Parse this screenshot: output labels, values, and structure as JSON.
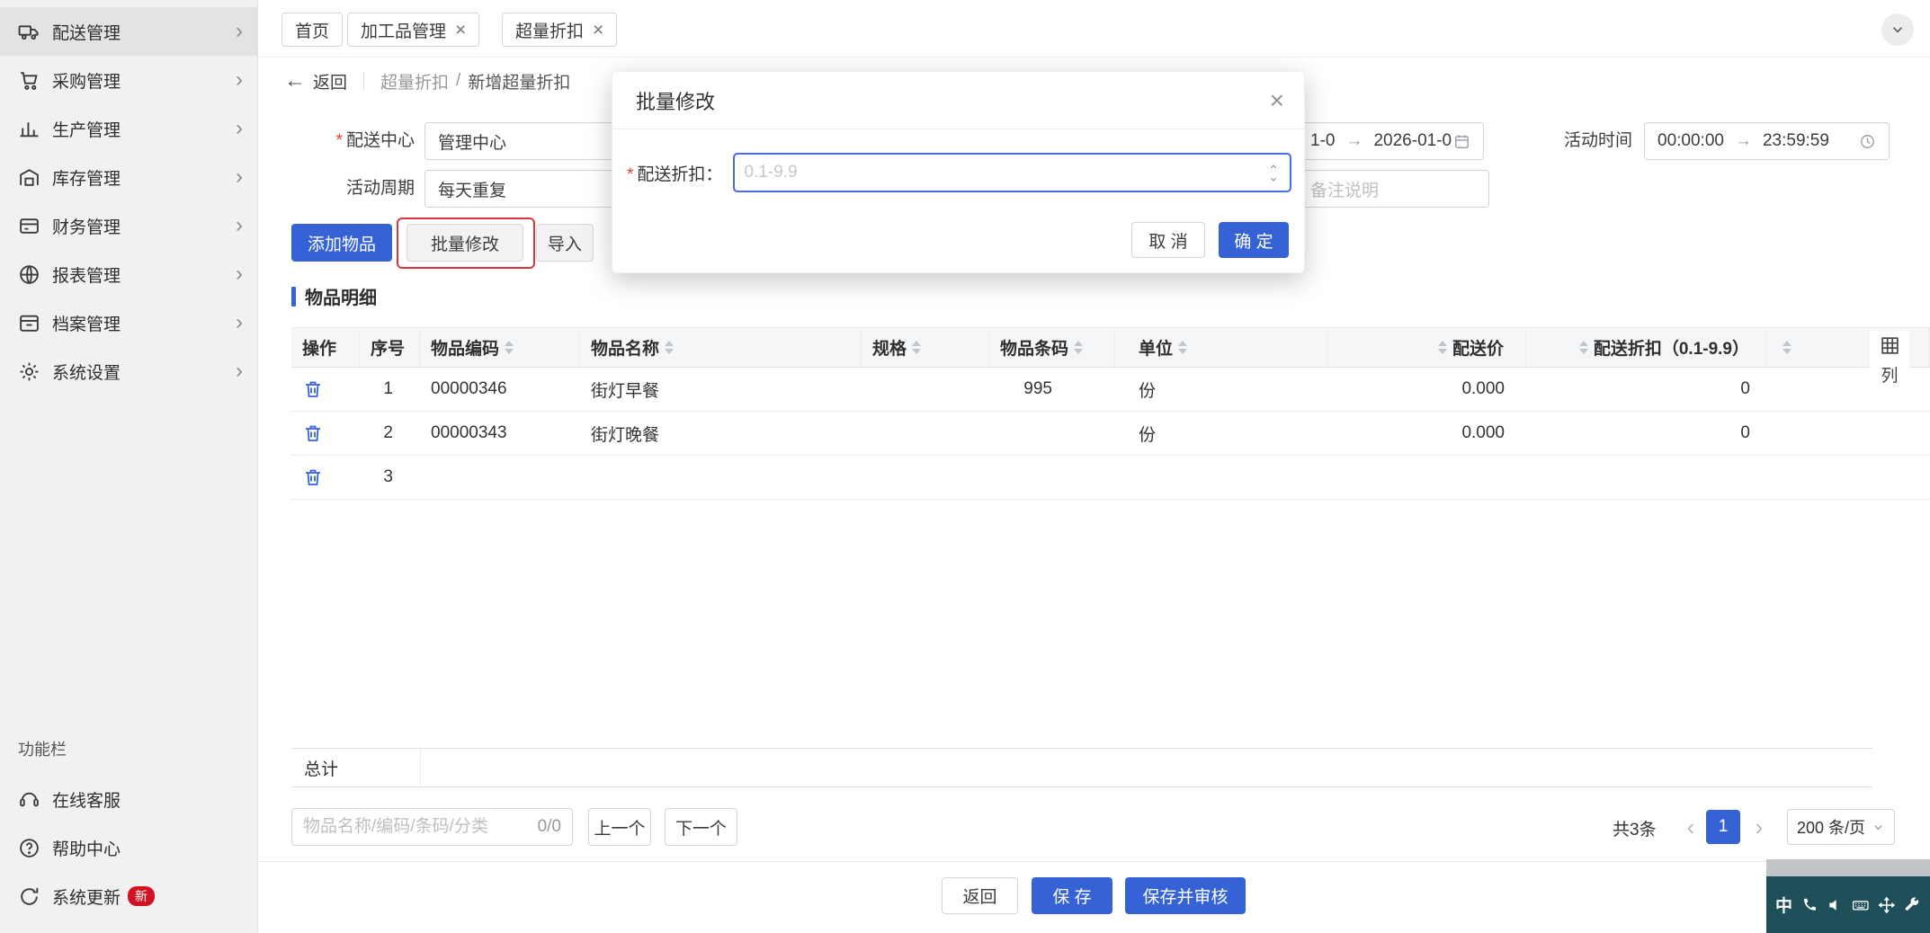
{
  "colors": {
    "primary": "#3563d6",
    "danger": "#d9363e",
    "badge": "#cf1322"
  },
  "icons": {
    "close": "×",
    "back": "←",
    "range_arrow": "→",
    "chevron_right": "›",
    "page_prev": "‹",
    "page_next": "›",
    "required": "*"
  },
  "sidebar": {
    "items": [
      {
        "label": "配送管理",
        "icon": "delivery-truck-icon"
      },
      {
        "label": "采购管理",
        "icon": "cart-icon"
      },
      {
        "label": "生产管理",
        "icon": "production-chart-icon"
      },
      {
        "label": "库存管理",
        "icon": "warehouse-icon"
      },
      {
        "label": "财务管理",
        "icon": "finance-icon"
      },
      {
        "label": "报表管理",
        "icon": "report-globe-icon"
      },
      {
        "label": "档案管理",
        "icon": "archive-icon"
      },
      {
        "label": "系统设置",
        "icon": "gear-icon"
      }
    ],
    "section_label": "功能栏",
    "bottom_items": [
      {
        "label": "在线客服",
        "icon": "service-icon"
      },
      {
        "label": "帮助中心",
        "icon": "help-icon"
      },
      {
        "label": "系统更新",
        "icon": "update-icon",
        "badge": "新"
      }
    ]
  },
  "tabs": [
    {
      "label": "首页"
    },
    {
      "label": "加工品管理"
    },
    {
      "label": "超量折扣"
    }
  ],
  "breadcrumb": {
    "back_label": "返回",
    "parent": "超量折扣",
    "separator": "/",
    "current": "新增超量折扣"
  },
  "form": {
    "delivery_center": {
      "label": "配送中心",
      "value": "管理中心"
    },
    "activity_cycle": {
      "label": "活动周期",
      "value": "每天重复"
    },
    "date_range": {
      "start_visible": "1-0",
      "end_visible": "2026-01-0"
    },
    "activity_time": {
      "label": "活动时间",
      "start": "00:00:00",
      "end": "23:59:59"
    },
    "remark_placeholder": "备注说明"
  },
  "toolbar": {
    "add_item": "添加物品",
    "batch_edit": "批量修改",
    "import": "导入"
  },
  "modal": {
    "title": "批量修改",
    "field_label": "配送折扣：",
    "placeholder": "0.1-9.9",
    "cancel": "取 消",
    "confirm": "确 定"
  },
  "section_title": "物品明细",
  "table": {
    "columns": [
      {
        "label": "操作"
      },
      {
        "label": "序号"
      },
      {
        "label": "物品编码"
      },
      {
        "label": "物品名称"
      },
      {
        "label": "规格"
      },
      {
        "label": "物品条码"
      },
      {
        "label": "单位"
      },
      {
        "label": "配送价"
      },
      {
        "label": "配送折扣（0.1-9.9）"
      },
      {
        "label": ""
      }
    ],
    "rows": [
      {
        "seq": "1",
        "code": "00000346",
        "name": "街灯早餐",
        "spec": "",
        "barcode": "995",
        "unit": "份",
        "price": "0.000",
        "discount": "0"
      },
      {
        "seq": "2",
        "code": "00000343",
        "name": "街灯晚餐",
        "spec": "",
        "barcode": "",
        "unit": "份",
        "price": "0.000",
        "discount": "0"
      },
      {
        "seq": "3",
        "code": "",
        "name": "",
        "spec": "",
        "barcode": "",
        "unit": "",
        "price": "",
        "discount": ""
      }
    ],
    "total_label": "总计",
    "column_settings_label": "列"
  },
  "listbar": {
    "search_placeholder": "物品名称/编码/条码/分类",
    "counter": "0/0",
    "prev": "上一个",
    "next": "下一个"
  },
  "pagination": {
    "total": "共3条",
    "page": "1",
    "page_size": "200 条/页"
  },
  "footer": {
    "back": "返回",
    "save": "保 存",
    "save_audit": "保存并审核"
  },
  "taskbar": {
    "lang": "中"
  }
}
